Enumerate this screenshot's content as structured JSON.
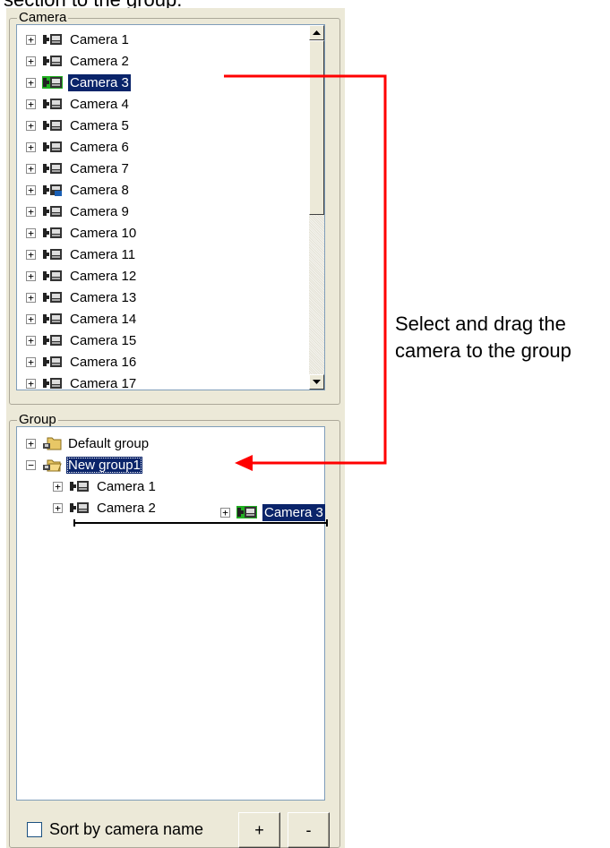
{
  "caption": {
    "top_text": "section to the group."
  },
  "camera_panel": {
    "legend": "Camera",
    "items": [
      {
        "label": "Camera 1",
        "icon": "camera-icon",
        "selected": false
      },
      {
        "label": "Camera 2",
        "icon": "camera-icon",
        "selected": false
      },
      {
        "label": "Camera 3",
        "icon": "camera-icon",
        "selected": true
      },
      {
        "label": "Camera 4",
        "icon": "camera-icon",
        "selected": false
      },
      {
        "label": "Camera 5",
        "icon": "camera-icon",
        "selected": false
      },
      {
        "label": "Camera 6",
        "icon": "camera-icon",
        "selected": false
      },
      {
        "label": "Camera 7",
        "icon": "camera-icon",
        "selected": false
      },
      {
        "label": "Camera 8",
        "icon": "ip-camera-icon",
        "selected": false
      },
      {
        "label": "Camera 9",
        "icon": "camera-icon",
        "selected": false
      },
      {
        "label": "Camera 10",
        "icon": "camera-icon",
        "selected": false
      },
      {
        "label": "Camera 11",
        "icon": "camera-icon",
        "selected": false
      },
      {
        "label": "Camera 12",
        "icon": "camera-icon",
        "selected": false
      },
      {
        "label": "Camera 13",
        "icon": "camera-icon",
        "selected": false
      },
      {
        "label": "Camera 14",
        "icon": "camera-icon",
        "selected": false
      },
      {
        "label": "Camera 15",
        "icon": "camera-icon",
        "selected": false
      },
      {
        "label": "Camera 16",
        "icon": "camera-icon",
        "selected": false
      },
      {
        "label": "Camera 17",
        "icon": "camera-icon",
        "selected": false
      }
    ]
  },
  "group_panel": {
    "legend": "Group",
    "groups": [
      {
        "label": "Default group",
        "expander": "+",
        "selected": false
      },
      {
        "label": "New group1",
        "expander": "−",
        "selected": true,
        "children": [
          {
            "label": "Camera 1",
            "expander": "+"
          },
          {
            "label": "Camera 2",
            "expander": "+"
          }
        ]
      }
    ],
    "drag_item": {
      "label": "Camera 3",
      "expander": "+"
    }
  },
  "bottom": {
    "sort_label": "Sort by camera name",
    "add_label": "+",
    "remove_label": "-"
  },
  "annotation": {
    "line1": "Select and drag the",
    "line2": "camera to the group",
    "arrow_color": "#ff0000"
  },
  "colors": {
    "selection": "#0a246a",
    "active_camera": "#21b021",
    "panel_bg": "#ece9d8"
  }
}
